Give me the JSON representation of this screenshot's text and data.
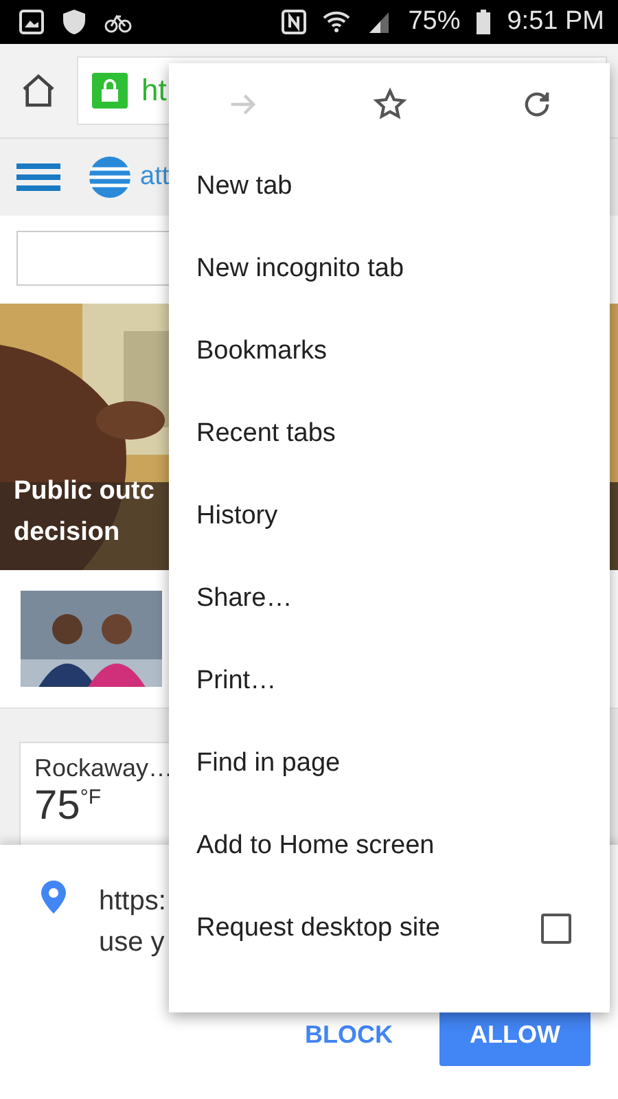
{
  "status_bar": {
    "battery": "75%",
    "time": "9:51 PM"
  },
  "toolbar": {
    "url": "ht",
    "secure": true
  },
  "site": {
    "logo_text": "att"
  },
  "hero": {
    "headline": [
      "Public outc",
      "decision"
    ]
  },
  "weather": {
    "place": "Rockaway…",
    "temp": "75",
    "unit": "°F"
  },
  "permission": {
    "lines": [
      "https:",
      "use y"
    ],
    "buttons": [
      {
        "label": "BLOCK",
        "kind": "text"
      },
      {
        "label": "ALLOW",
        "kind": "filled"
      }
    ]
  },
  "menu": {
    "actions": [
      {
        "kind": "forward",
        "disabled": true
      },
      {
        "kind": "star",
        "disabled": false
      },
      {
        "kind": "reload",
        "disabled": false
      }
    ],
    "items": [
      {
        "label": "New tab",
        "kind": "plain"
      },
      {
        "label": "New incognito tab",
        "kind": "plain"
      },
      {
        "label": "Bookmarks",
        "kind": "plain"
      },
      {
        "label": "Recent tabs",
        "kind": "plain"
      },
      {
        "label": "History",
        "kind": "plain"
      },
      {
        "label": "Share…",
        "kind": "plain"
      },
      {
        "label": "Print…",
        "kind": "plain"
      },
      {
        "label": "Find in page",
        "kind": "plain"
      },
      {
        "label": "Add to Home screen",
        "kind": "plain"
      },
      {
        "label": "Request desktop site",
        "kind": "checkbox",
        "checked": false
      }
    ]
  }
}
